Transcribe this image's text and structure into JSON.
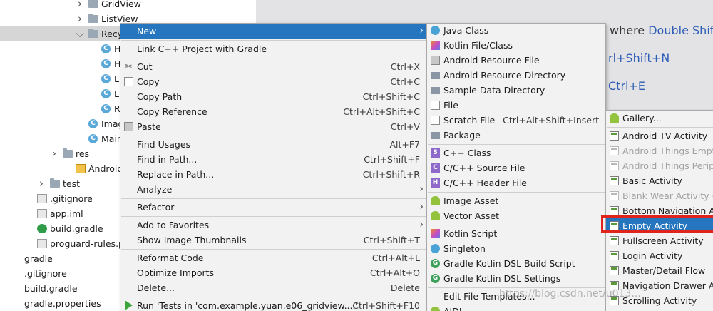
{
  "tree": [
    {
      "label": "GridView",
      "kind": "folder",
      "depth": 3,
      "arrow": "right"
    },
    {
      "label": "ListView",
      "kind": "folder",
      "depth": 3,
      "arrow": "right"
    },
    {
      "label": "RecycleVie",
      "kind": "folder",
      "depth": 3,
      "arrow": "down",
      "selected": true
    },
    {
      "label": "HorLine",
      "kind": "class",
      "depth": 4
    },
    {
      "label": "HorLine",
      "kind": "class",
      "depth": 4
    },
    {
      "label": "LinearA",
      "kind": "class",
      "depth": 4
    },
    {
      "label": "LinearR",
      "kind": "class",
      "depth": 4
    },
    {
      "label": "Recycle",
      "kind": "class",
      "depth": 4
    },
    {
      "label": "ImageView",
      "kind": "class",
      "depth": 3
    },
    {
      "label": "MainActivit",
      "kind": "class",
      "depth": 3
    },
    {
      "label": "res",
      "kind": "folder",
      "depth": 1,
      "arrow": "right"
    },
    {
      "label": "AndroidManifest.",
      "kind": "manifest",
      "depth": 2
    },
    {
      "label": "test",
      "kind": "folder",
      "depth": 0,
      "arrow": "right"
    },
    {
      "label": ".gitignore",
      "kind": "file",
      "depth": -1
    },
    {
      "label": "app.iml",
      "kind": "file",
      "depth": -1
    },
    {
      "label": "build.gradle",
      "kind": "gradle",
      "depth": -1
    },
    {
      "label": "proguard-rules.pro",
      "kind": "file",
      "depth": -1
    },
    {
      "label": "gradle",
      "kind": "none",
      "depth": -2
    },
    {
      "label": ".gitignore",
      "kind": "none",
      "depth": -2
    },
    {
      "label": "build.gradle",
      "kind": "none",
      "depth": -2
    },
    {
      "label": "gradle.properties",
      "kind": "none",
      "depth": -2
    }
  ],
  "editor_hints": [
    {
      "text": "where ",
      "key": "Double Shift"
    },
    {
      "text": "",
      "key": "rl+Shift+N"
    },
    {
      "text": "",
      "key": "Ctrl+E"
    }
  ],
  "menu1": [
    {
      "label": "New",
      "submenu": true,
      "highlight": true
    },
    {
      "sep": true
    },
    {
      "label": "Link C++ Project with Gradle"
    },
    {
      "sep": true
    },
    {
      "label": "Cut",
      "shortcut": "Ctrl+X",
      "icon": "scissors-icon"
    },
    {
      "label": "Copy",
      "shortcut": "Ctrl+C",
      "icon": "copy-icon"
    },
    {
      "label": "Copy Path",
      "shortcut": "Ctrl+Shift+C"
    },
    {
      "label": "Copy Reference",
      "shortcut": "Ctrl+Alt+Shift+C"
    },
    {
      "label": "Paste",
      "shortcut": "Ctrl+V",
      "icon": "paste-icon"
    },
    {
      "sep": true
    },
    {
      "label": "Find Usages",
      "shortcut": "Alt+F7"
    },
    {
      "label": "Find in Path...",
      "shortcut": "Ctrl+Shift+F"
    },
    {
      "label": "Replace in Path...",
      "shortcut": "Ctrl+Shift+R"
    },
    {
      "label": "Analyze",
      "submenu": true
    },
    {
      "sep": true
    },
    {
      "label": "Refactor",
      "submenu": true
    },
    {
      "sep": true
    },
    {
      "label": "Add to Favorites",
      "submenu": true
    },
    {
      "label": "Show Image Thumbnails",
      "shortcut": "Ctrl+Shift+T"
    },
    {
      "sep": true
    },
    {
      "label": "Reformat Code",
      "shortcut": "Ctrl+Alt+L"
    },
    {
      "label": "Optimize Imports",
      "shortcut": "Ctrl+Alt+O"
    },
    {
      "label": "Delete...",
      "shortcut": "Delete"
    },
    {
      "sep": true
    },
    {
      "label": "Run 'Tests in 'com.example.yuan.e06_gridview....'",
      "shortcut": "Ctrl+Shift+F10",
      "icon": "run-icon"
    }
  ],
  "menu2": [
    {
      "label": "Java Class",
      "icon": "java"
    },
    {
      "label": "Kotlin File/Class",
      "icon": "kotlin"
    },
    {
      "label": "Android Resource File",
      "icon": "res"
    },
    {
      "label": "Android Resource Directory",
      "icon": "folder"
    },
    {
      "label": "Sample Data Directory",
      "icon": "folder"
    },
    {
      "label": "File",
      "icon": "file"
    },
    {
      "label": "Scratch File",
      "icon": "file",
      "shortcut": "Ctrl+Alt+Shift+Insert"
    },
    {
      "label": "Package",
      "icon": "folder"
    },
    {
      "sep": true
    },
    {
      "label": "C++ Class",
      "icon": "cpp",
      "glyph": "S"
    },
    {
      "label": "C/C++ Source File",
      "icon": "cpp",
      "glyph": "C"
    },
    {
      "label": "C/C++ Header File",
      "icon": "cpp",
      "glyph": "H"
    },
    {
      "sep": true
    },
    {
      "label": "Image Asset",
      "icon": "android"
    },
    {
      "label": "Vector Asset",
      "icon": "android"
    },
    {
      "sep": true
    },
    {
      "label": "Kotlin Script",
      "icon": "kotlin"
    },
    {
      "label": "Singleton",
      "icon": "java"
    },
    {
      "label": "Gradle Kotlin DSL Build Script",
      "icon": "gradle",
      "glyph": "G"
    },
    {
      "label": "Gradle Kotlin DSL Settings",
      "icon": "gradle",
      "glyph": "G"
    },
    {
      "sep": true
    },
    {
      "label": "Edit File Templates..."
    },
    {
      "label": "AIDL",
      "icon": "android"
    }
  ],
  "menu3": [
    {
      "label": "Gallery...",
      "icon": "android"
    },
    {
      "sep": true
    },
    {
      "label": "Android TV Activity",
      "icon": "act"
    },
    {
      "label": "Android Things Empty",
      "icon": "act",
      "disabled": true
    },
    {
      "label": "Android Things Periph",
      "icon": "act",
      "disabled": true
    },
    {
      "label": "Basic Activity",
      "icon": "act"
    },
    {
      "label": "Blank Wear Activity (R",
      "icon": "act",
      "disabled": true
    },
    {
      "label": "Bottom Navigation Ac",
      "icon": "act"
    },
    {
      "label": "Empty Activity",
      "icon": "act",
      "highlight": true
    },
    {
      "label": "Fullscreen Activity",
      "icon": "act"
    },
    {
      "label": "Login Activity",
      "icon": "act"
    },
    {
      "label": "Master/Detail Flow",
      "icon": "act"
    },
    {
      "label": "Navigation Drawer Ac",
      "icon": "act"
    },
    {
      "label": "Scrolling Activity",
      "icon": "act"
    }
  ],
  "watermark": "https://blog.csdn.net/u013..."
}
